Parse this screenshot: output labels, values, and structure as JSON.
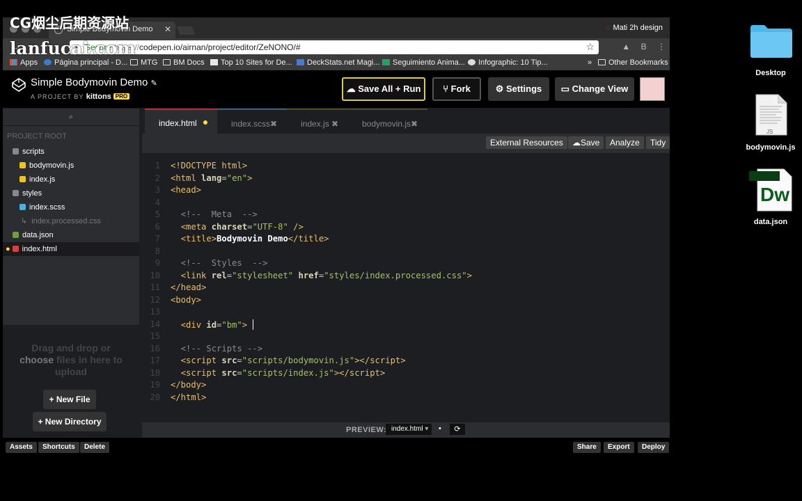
{
  "watermark": {
    "line1": "CG烟尘后期资源站",
    "line2": "lanfucai.com"
  },
  "browser": {
    "tab_title": "Simple Bodymovin Demo",
    "tab_close": "✕",
    "profile": "Mati 2h design",
    "secure_label": "Secure",
    "url_scheme": "https://",
    "url_rest": "codepen.io/airnan/project/editor/ZeNONO/#",
    "extension_letter": "B",
    "bookmarks": [
      "Apps",
      "Página principal - D...",
      "MTG",
      "BM Docs",
      "Top 10 Sites for De...",
      "DeckStats.net Magi...",
      "Seguimiento Anima...",
      "Infographic: 10 Tip...",
      "Other Bookmarks"
    ],
    "bookmarks_more": "»"
  },
  "codepen": {
    "title": "Simple Bodymovin Demo",
    "by_prefix": "A PROJECT BY",
    "author": "kittons",
    "pro_badge": "PRO",
    "buttons": {
      "save_run": "Save All + Run",
      "fork": "Fork",
      "settings": "Settings",
      "change_view": "Change View"
    }
  },
  "sidebar": {
    "project_root": "PROJECT ROOT",
    "items": [
      {
        "label": "scripts",
        "type": "folder"
      },
      {
        "label": "bodymovin.js",
        "type": "js"
      },
      {
        "label": "index.js",
        "type": "js"
      },
      {
        "label": "styles",
        "type": "folder"
      },
      {
        "label": "index.scss",
        "type": "scss"
      },
      {
        "label": "index.processed.css",
        "type": "processed"
      },
      {
        "label": "data.json",
        "type": "json"
      },
      {
        "label": "index.html",
        "type": "html"
      }
    ],
    "drop_line1": "Drag and drop or",
    "drop_choose": "choose",
    "drop_line2": "files in here to",
    "drop_line3": "upload",
    "new_file": "+ New File",
    "new_directory": "+ New Directory"
  },
  "editor": {
    "tabs": [
      "index.html",
      "index.scss",
      "index.js",
      "bodymovin.js"
    ],
    "actions": {
      "external": "External Resources",
      "save": "Save",
      "analyze": "Analyze",
      "tidy": "Tidy"
    },
    "line_numbers": [
      "1",
      "2",
      "3",
      "4",
      "5",
      "6",
      "7",
      "8",
      "9",
      "10",
      "11",
      "12",
      "13",
      "14",
      "15",
      "16",
      "17",
      "18",
      "19",
      "20"
    ]
  },
  "preview": {
    "label": "PREVIEW:",
    "file": "index.html",
    "dot": "•",
    "refresh": "⟳"
  },
  "bottom": {
    "assets": "Assets",
    "shortcuts": "Shortcuts",
    "delete": "Delete",
    "share": "Share",
    "export": "Export",
    "deploy": "Deploy"
  },
  "desktop": {
    "folder": "Desktop",
    "js_file": "bodymovin.js",
    "js_tag": "JS",
    "json_file": "data.json",
    "dw_tag": "Dw"
  },
  "colors": {
    "accent_yellow": "#dfcc3a",
    "active_tab_border": "#b42d3d",
    "folder_blue": "#5ac8f5",
    "dw_green": "#0b5d1e"
  }
}
